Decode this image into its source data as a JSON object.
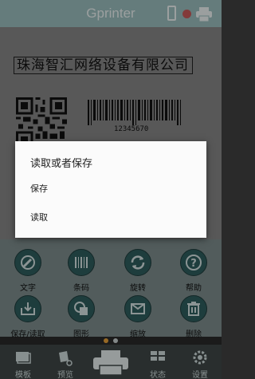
{
  "header": {
    "title": "Gprinter"
  },
  "canvas": {
    "label_text": "珠海智汇网络设备有限公司",
    "barcode_value": "12345670"
  },
  "toolbar": {
    "row1": [
      {
        "label": "文字",
        "icon": "text-icon"
      },
      {
        "label": "条码",
        "icon": "barcode-icon"
      },
      {
        "label": "旋转",
        "icon": "rotate-icon"
      },
      {
        "label": "帮助",
        "icon": "help-icon"
      }
    ],
    "row2": [
      {
        "label": "保存/读取",
        "icon": "save-load-icon"
      },
      {
        "label": "图形",
        "icon": "shape-icon"
      },
      {
        "label": "缩放",
        "icon": "zoom-icon"
      },
      {
        "label": "删除",
        "icon": "trash-icon"
      }
    ]
  },
  "bottom_nav": [
    {
      "label": "模板",
      "icon": "template-icon"
    },
    {
      "label": "预览",
      "icon": "preview-icon"
    },
    {
      "label": "",
      "icon": "print-icon"
    },
    {
      "label": "状态",
      "icon": "status-icon"
    },
    {
      "label": "设置",
      "icon": "settings-icon"
    }
  ],
  "dialog": {
    "title": "读取或者保存",
    "items": [
      "保存",
      "读取"
    ]
  },
  "colors": {
    "header_bg": "#9bbfbf",
    "toolbar_bg": "#7e8e8e",
    "icon_circle": "#2f5e5e",
    "nav_bg": "#3f4848"
  }
}
